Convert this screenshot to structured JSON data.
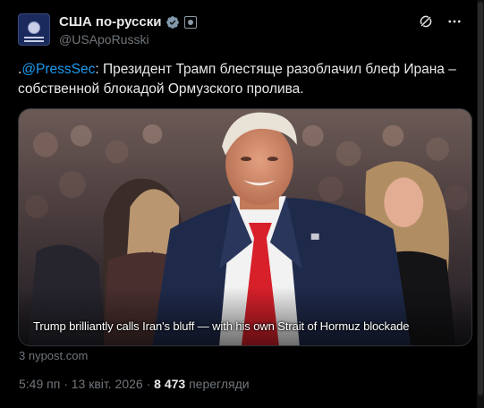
{
  "account": {
    "name": "США по-русски",
    "handle": "@USApoRusski"
  },
  "tweet": {
    "prefix": ".",
    "mention": "@PressSec",
    "text": ": Президент Трамп блестяще разоблачил блеф Ирана – собственной блокадой Ормузского пролива."
  },
  "media": {
    "caption": "Trump brilliantly calls Iran's bluff — with his own Strait of Hormuz blockade"
  },
  "source": "3 nypost.com",
  "meta": {
    "time": "5:49 пп",
    "separator": "·",
    "date": "13 квіт. 2026",
    "views_count": "8 473",
    "views_label": "перегляди"
  },
  "colors": {
    "background": "#000000",
    "text": "#e7e9ea",
    "muted": "#71767b",
    "link": "#1d9bf0",
    "verified": "#829aab",
    "tie": "#d8202a"
  },
  "icons": {
    "verified": "verified-badge-icon",
    "affiliate": "affiliate-badge-icon",
    "grok": "grok-icon",
    "more": "more-icon"
  }
}
